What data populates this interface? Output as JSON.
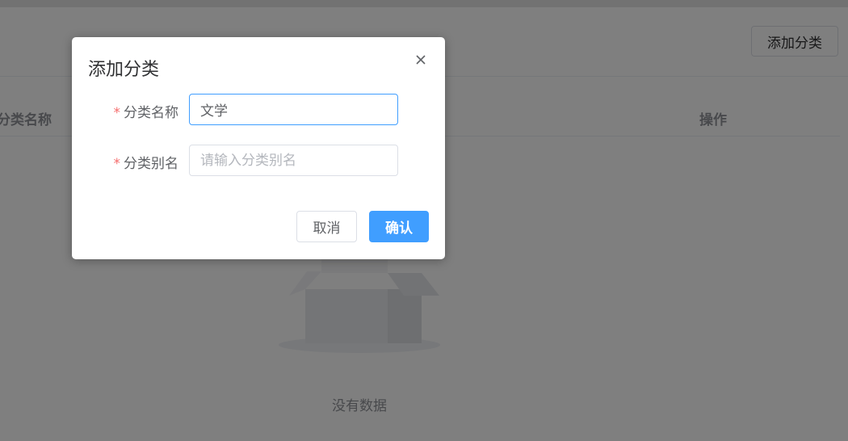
{
  "header": {
    "add_button_label": "添加分类"
  },
  "table": {
    "columns": [
      "分类名称",
      "操作"
    ],
    "empty_text": "没有数据"
  },
  "dialog": {
    "title": "添加分类",
    "fields": [
      {
        "label": "分类名称",
        "required_mark": "*",
        "value": "文学",
        "placeholder": ""
      },
      {
        "label": "分类别名",
        "required_mark": "*",
        "value": "",
        "placeholder": "请输入分类别名"
      }
    ],
    "cancel_label": "取消",
    "confirm_label": "确认"
  },
  "colors": {
    "primary": "#409eff",
    "required": "#f56c6c",
    "overlay": "rgba(0,0,0,0.5)"
  },
  "icons": {
    "close": "close-icon"
  }
}
